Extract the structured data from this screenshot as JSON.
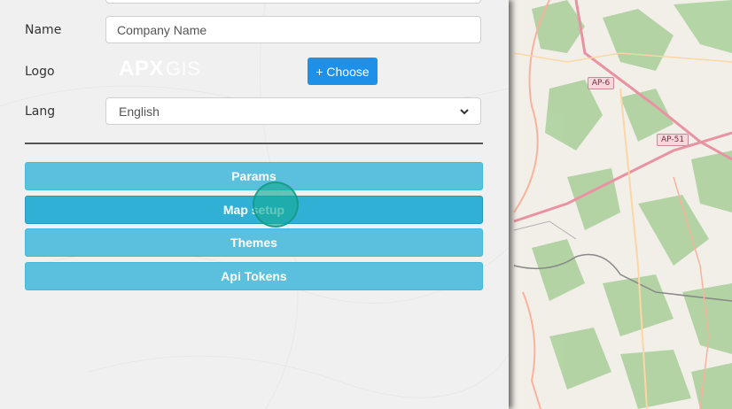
{
  "form": {
    "name_label": "Name",
    "name_placeholder": "Company Name",
    "logo_label": "Logo",
    "logo_text_main": "APX",
    "logo_text_suffix": "GIS",
    "choose_label": "+ Choose",
    "lang_label": "Lang",
    "lang_value": "English"
  },
  "buttons": {
    "params": "Params",
    "map_setup": "Map setup",
    "themes": "Themes",
    "api_tokens": "Api Tokens"
  },
  "map": {
    "shields": [
      "AP-6",
      "AP-51"
    ]
  },
  "colors": {
    "accent_blue": "#1e90e8",
    "info_button": "#5bc0de",
    "click_indicator": "#16aa96"
  }
}
